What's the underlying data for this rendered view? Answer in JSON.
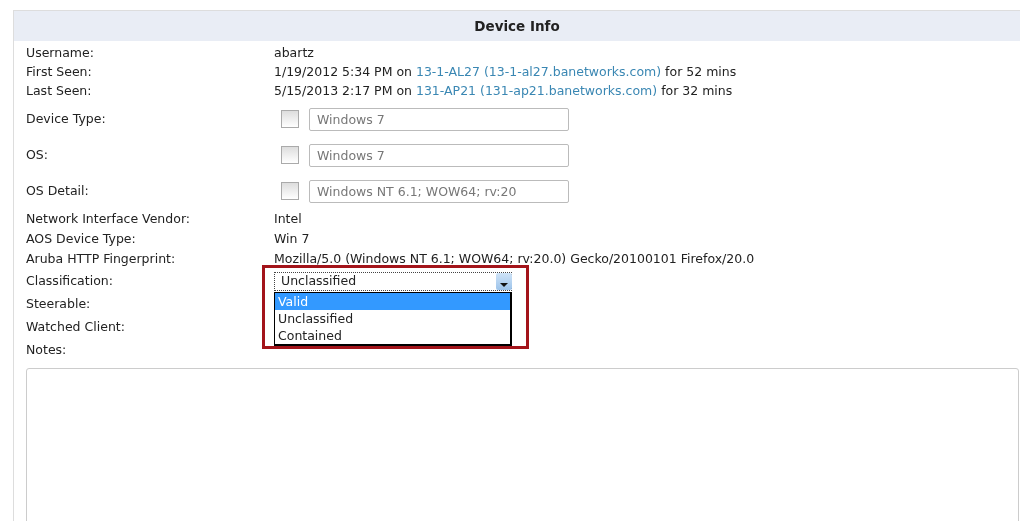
{
  "panel": {
    "title": "Device Info"
  },
  "rows": [
    {
      "kind": "text",
      "label": "Username:",
      "value": "abartz"
    },
    {
      "kind": "seen",
      "label": "First Seen:",
      "before": "1/19/2012 5:34 PM on",
      "link": "13-1-AL27 (13-1-al27.banetworks.com)",
      "after": "for 52 mins"
    },
    {
      "kind": "seen",
      "label": "Last Seen:",
      "before": "5/15/2013 2:17 PM on",
      "link": "131-AP21 (131-ap21.banetworks.com)",
      "after": "for 32 mins"
    },
    {
      "kind": "override",
      "label": "Device Type:",
      "checked": false,
      "value": "Windows 7"
    },
    {
      "kind": "override",
      "label": "OS:",
      "checked": false,
      "value": "Windows 7"
    },
    {
      "kind": "override",
      "label": "OS Detail:",
      "checked": false,
      "value": "Windows NT 6.1; WOW64; rv:20"
    },
    {
      "kind": "text",
      "label": "Network Interface Vendor:",
      "value": "Intel"
    },
    {
      "kind": "text",
      "label": "AOS Device Type:",
      "value": "Win 7"
    },
    {
      "kind": "text",
      "label": "Aruba HTTP Fingerprint:",
      "value": "Mozilla/5.0 (Windows NT 6.1; WOW64; rv:20.0) Gecko/20100101 Firefox/20.0"
    },
    {
      "kind": "select",
      "label": "Classification:",
      "value": "Unclassified",
      "expanded": true,
      "highlighted": true,
      "options": [
        {
          "label": "Valid",
          "highlighted": true
        },
        {
          "label": "Unclassified",
          "highlighted": false
        },
        {
          "label": "Contained",
          "highlighted": false
        }
      ]
    },
    {
      "kind": "blank",
      "label": "Steerable:"
    },
    {
      "kind": "blank",
      "label": "Watched Client:"
    },
    {
      "kind": "blank",
      "label": "Notes:"
    }
  ]
}
